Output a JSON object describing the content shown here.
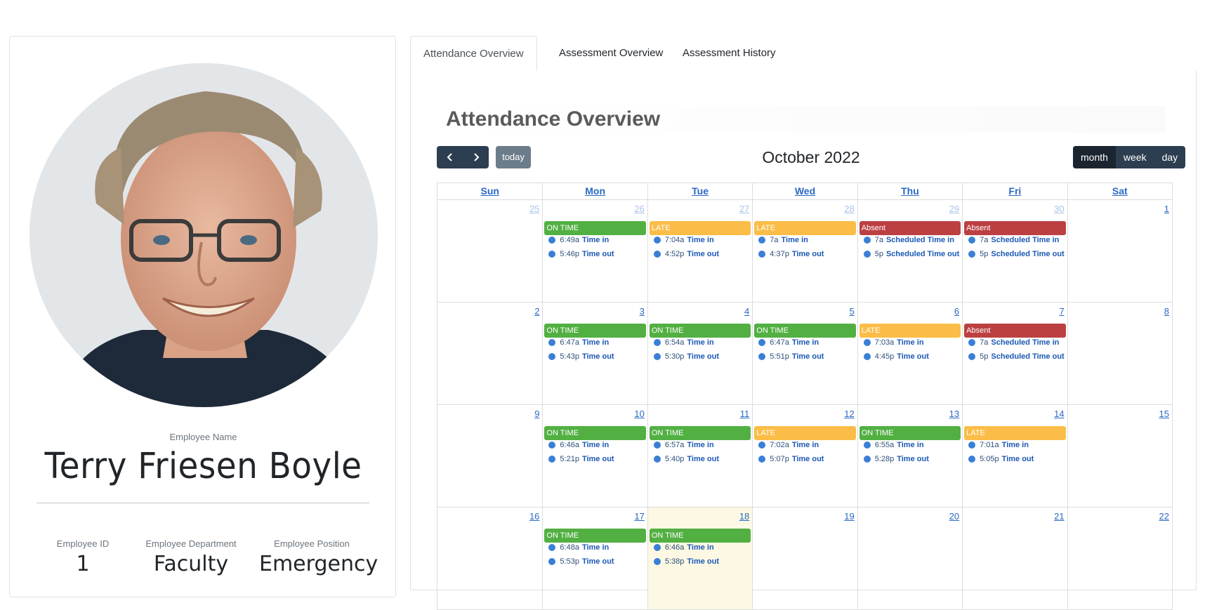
{
  "profile": {
    "name_label": "Employee Name",
    "name": "Terry Friesen Boyle",
    "id_label": "Employee ID",
    "id": "1",
    "department_label": "Employee Department",
    "department": "Faculty",
    "position_label": "Employee Position",
    "position": "Emergency"
  },
  "tabs": [
    {
      "label": "Attendance Overview",
      "active": true
    },
    {
      "label": "Assessment Overview",
      "active": false
    },
    {
      "label": "Assessment History",
      "active": false
    }
  ],
  "panel_title": "Attendance Overview",
  "toolbar": {
    "prev_icon": "chevron-left-icon",
    "next_icon": "chevron-right-icon",
    "today_label": "today",
    "title": "October 2022",
    "views": [
      {
        "label": "month",
        "active": true
      },
      {
        "label": "week",
        "active": false
      },
      {
        "label": "day",
        "active": false
      }
    ]
  },
  "colors": {
    "on_time": "#52b043",
    "late": "#fbbd47",
    "absent": "#bc4042",
    "nav": "#2c3e50",
    "today_bg": "#fcf8e3"
  },
  "weekdays": [
    "Sun",
    "Mon",
    "Tue",
    "Wed",
    "Thu",
    "Fri",
    "Sat"
  ],
  "weeks": [
    [
      {
        "day": "25",
        "other": true
      },
      {
        "day": "26",
        "other": true,
        "status": "ON TIME",
        "events": [
          {
            "time": "6:49a",
            "label": "Time in"
          },
          {
            "time": "5:46p",
            "label": "Time out"
          }
        ]
      },
      {
        "day": "27",
        "other": true,
        "status": "LATE",
        "events": [
          {
            "time": "7:04a",
            "label": "Time in"
          },
          {
            "time": "4:52p",
            "label": "Time out"
          }
        ]
      },
      {
        "day": "28",
        "other": true,
        "status": "LATE",
        "events": [
          {
            "time": "7a",
            "label": "Time in"
          },
          {
            "time": "4:37p",
            "label": "Time out"
          }
        ]
      },
      {
        "day": "29",
        "other": true,
        "status": "Absent",
        "events": [
          {
            "time": "7a",
            "label": "Scheduled Time in"
          },
          {
            "time": "5p",
            "label": "Scheduled Time out"
          }
        ]
      },
      {
        "day": "30",
        "other": true,
        "status": "Absent",
        "events": [
          {
            "time": "7a",
            "label": "Scheduled Time in"
          },
          {
            "time": "5p",
            "label": "Scheduled Time out"
          }
        ]
      },
      {
        "day": "1"
      }
    ],
    [
      {
        "day": "2"
      },
      {
        "day": "3",
        "status": "ON TIME",
        "events": [
          {
            "time": "6:47a",
            "label": "Time in"
          },
          {
            "time": "5:43p",
            "label": "Time out"
          }
        ]
      },
      {
        "day": "4",
        "status": "ON TIME",
        "events": [
          {
            "time": "6:54a",
            "label": "Time in"
          },
          {
            "time": "5:30p",
            "label": "Time out"
          }
        ]
      },
      {
        "day": "5",
        "status": "ON TIME",
        "events": [
          {
            "time": "6:47a",
            "label": "Time in"
          },
          {
            "time": "5:51p",
            "label": "Time out"
          }
        ]
      },
      {
        "day": "6",
        "status": "LATE",
        "events": [
          {
            "time": "7:03a",
            "label": "Time in"
          },
          {
            "time": "4:45p",
            "label": "Time out"
          }
        ]
      },
      {
        "day": "7",
        "status": "Absent",
        "events": [
          {
            "time": "7a",
            "label": "Scheduled Time in"
          },
          {
            "time": "5p",
            "label": "Scheduled Time out"
          }
        ]
      },
      {
        "day": "8"
      }
    ],
    [
      {
        "day": "9"
      },
      {
        "day": "10",
        "status": "ON TIME",
        "events": [
          {
            "time": "6:46a",
            "label": "Time in"
          },
          {
            "time": "5:21p",
            "label": "Time out"
          }
        ]
      },
      {
        "day": "11",
        "status": "ON TIME",
        "events": [
          {
            "time": "6:57a",
            "label": "Time in"
          },
          {
            "time": "5:40p",
            "label": "Time out"
          }
        ]
      },
      {
        "day": "12",
        "status": "LATE",
        "events": [
          {
            "time": "7:02a",
            "label": "Time in"
          },
          {
            "time": "5:07p",
            "label": "Time out"
          }
        ]
      },
      {
        "day": "13",
        "status": "ON TIME",
        "events": [
          {
            "time": "6:55a",
            "label": "Time in"
          },
          {
            "time": "5:28p",
            "label": "Time out"
          }
        ]
      },
      {
        "day": "14",
        "status": "LATE",
        "events": [
          {
            "time": "7:01a",
            "label": "Time in"
          },
          {
            "time": "5:05p",
            "label": "Time out"
          }
        ]
      },
      {
        "day": "15"
      }
    ],
    [
      {
        "day": "16"
      },
      {
        "day": "17",
        "status": "ON TIME",
        "events": [
          {
            "time": "6:48a",
            "label": "Time in"
          },
          {
            "time": "5:53p",
            "label": "Time out"
          }
        ]
      },
      {
        "day": "18",
        "today": true,
        "status": "ON TIME",
        "events": [
          {
            "time": "6:46a",
            "label": "Time in"
          },
          {
            "time": "5:38p",
            "label": "Time out"
          }
        ]
      },
      {
        "day": "19"
      },
      {
        "day": "20"
      },
      {
        "day": "21"
      },
      {
        "day": "22"
      }
    ]
  ]
}
